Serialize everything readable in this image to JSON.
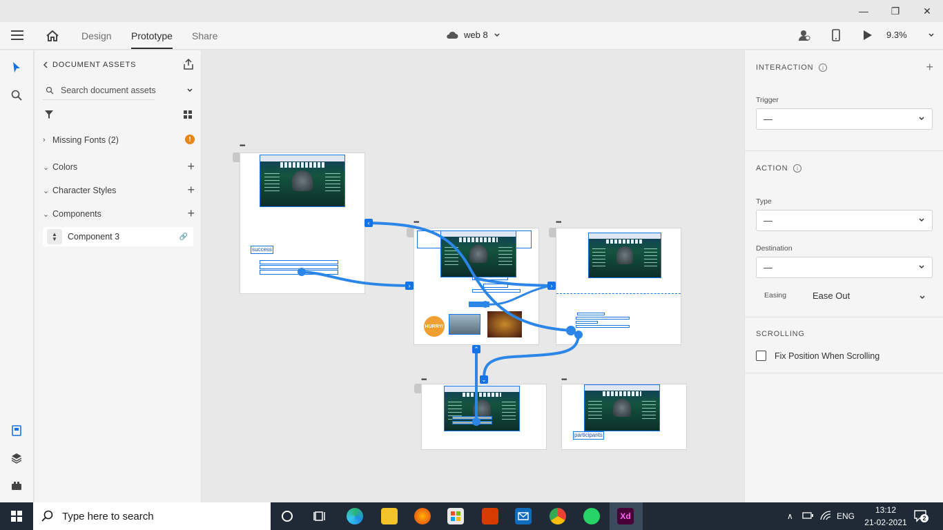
{
  "window": {
    "minimize": "—",
    "restore": "❐",
    "close": "✕"
  },
  "header": {
    "tabs": [
      {
        "label": "Design"
      },
      {
        "label": "Prototype"
      },
      {
        "label": "Share"
      }
    ],
    "doc_name": "web 8",
    "zoom": "9.3%"
  },
  "assets": {
    "title": "DOCUMENT ASSETS",
    "search_placeholder": "Search document assets",
    "sections": [
      {
        "label": "Missing Fonts (2)"
      },
      {
        "label": "Colors"
      },
      {
        "label": "Character Styles"
      },
      {
        "label": "Components"
      }
    ],
    "warning_badge": "!",
    "component_item": "Component 3"
  },
  "canvas": {
    "labels": {
      "success": "success",
      "participants": "participants"
    },
    "hurry_badge": "HURRY!"
  },
  "interaction_panel": {
    "interaction_title": "INTERACTION",
    "trigger_label": "Trigger",
    "trigger_value": "—",
    "action_title": "ACTION",
    "type_label": "Type",
    "type_value": "—",
    "destination_label": "Destination",
    "destination_value": "—",
    "easing_label": "Easing",
    "easing_value": "Ease Out",
    "scrolling_title": "SCROLLING",
    "fix_position_label": "Fix Position When Scrolling",
    "fix_position_checked": false
  },
  "taskbar": {
    "search_placeholder": "Type here to search",
    "apps": [
      "cortana-icon",
      "task-view-icon",
      "edge-icon",
      "file-explorer-icon",
      "firefox-icon",
      "store-icon",
      "office-icon",
      "mail-icon",
      "chrome-icon",
      "whatsapp-icon",
      "adobe-xd-icon"
    ],
    "xd_label": "Xd",
    "language": "ENG",
    "time": "13:12",
    "date": "21-02-2021",
    "notification_count": "2"
  },
  "colors": {
    "accent": "#1473e6",
    "warning": "#e68619",
    "taskbar": "#1f2a36"
  }
}
